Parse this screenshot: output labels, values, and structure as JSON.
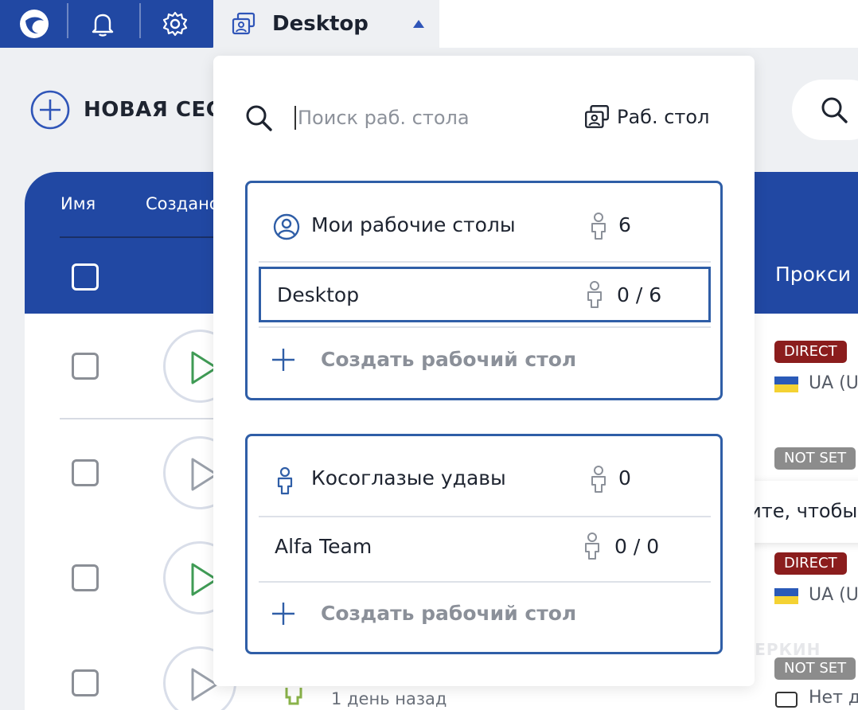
{
  "topbar": {
    "workspace_title": "Desktop",
    "icons": [
      "logo-icon",
      "bell-icon",
      "gear-icon",
      "desktop-icon",
      "caret-up-icon"
    ],
    "accent": "#2148a3"
  },
  "new_session": {
    "label": "НОВАЯ СЕСС"
  },
  "table": {
    "headers": {
      "name": "Имя",
      "created": "Создано",
      "proxy": "Прокси"
    },
    "rows": [
      {
        "proxy_badge": "DIRECT",
        "country": "UA (UI"
      },
      {
        "proxy_badge": "NOT SET",
        "country": ""
      },
      {
        "proxy_badge": "DIRECT",
        "country": "UA (UI"
      },
      {
        "proxy_badge": "NOT SET",
        "country": "Нет да",
        "created": "1 день назад"
      }
    ]
  },
  "tooltip": {
    "text": "Кликните, чтобы"
  },
  "watermark": {
    "text": "ПАРТНЕРКИН"
  },
  "dropdown": {
    "search_placeholder": "Поиск раб. стола",
    "desk_button_label": "Раб. стол",
    "groups": [
      {
        "name": "Мои рабочие столы",
        "count": "6",
        "desks": [
          {
            "name": "Desktop",
            "usage": "0 / 6",
            "selected": true
          }
        ],
        "create_label": "Создать рабочий стол"
      },
      {
        "name": "Косоглазые удавы",
        "count": "0",
        "desks": [
          {
            "name": "Alfa Team",
            "usage": "0 / 0",
            "selected": false
          }
        ],
        "create_label": "Создать рабочий стол"
      }
    ]
  },
  "colors": {
    "direct": "#8b1d1d",
    "notset": "#8c8c8c",
    "group_border": "#2f5ea7"
  }
}
